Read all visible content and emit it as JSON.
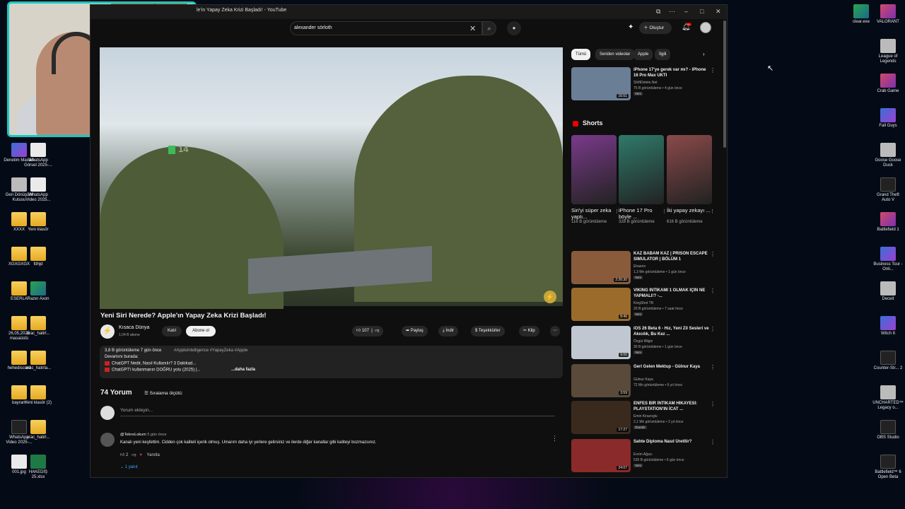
{
  "browser": {
    "tab_title": "le'in Yapay Zeka Krizi Başladı! - YouTube",
    "search_value": "alexander sörloth",
    "create_label": "Oluştur",
    "notif_count": "9+"
  },
  "video": {
    "badge": "14",
    "title": "Yeni Siri Nerede? Apple'ın Yapay Zeka Krizi Başladı!",
    "channel": "Kısaca Dünya",
    "subs": "1,04 B abone",
    "join": "Katıl",
    "subscribe": "Abone ol",
    "likes": "107",
    "share": "Paylaş",
    "download": "İndir",
    "thanks": "Teşekkürler",
    "clip": "Klip"
  },
  "description": {
    "stats": "3,8 B görüntüleme  7 gün önce",
    "tags": "#AppleIntelligence #YapayZeka #Apple",
    "line1": "Devamını burada:",
    "line2": "ChatGPT Nedir, Nasıl Kullanılır? 3 Dakikad...",
    "line3": "ChatGPT'i kullanmanın DOĞRU yolu (2025) |...",
    "more": "...daha fazla"
  },
  "comments": {
    "count": "74 Yorum",
    "sort": "Sıralama ölçütü:",
    "add_placeholder": "Yorum ekleyin...",
    "user": "@TeknoLokum",
    "time": "5 gün önce",
    "text": "Kanalı yeni keşfettim. Cidden çok kaliteli içerik olmuş. Umarım daha iyi yerlere gelirsiniz ve ilerde diğer kanallar gibi kaliteyi bozmazsınız.",
    "likes": "2",
    "reply": "Yanıtla",
    "replies": "1 yanıt"
  },
  "chips": [
    "Tümü",
    "Seriden videolar",
    "Apple",
    "İlgili"
  ],
  "recs": [
    {
      "title": "iPhone 17'ye gerek var mı? - iPhone 16 Pro Max UKTI",
      "channel": "ShiftDelete.Net",
      "views": "75 B görüntüleme • 4 gün önce",
      "badge": "Yeni",
      "dur": "16:51",
      "thumb": "#6a7f96"
    },
    {
      "title": "KAZ BABAM KAZ | PRISON ESCAPE SIMULATOR | BÖLÜM 1",
      "channel": "Elraenn",
      "views": "1,3 Mn görüntüleme • 1 gün önce",
      "badge": "Yeni",
      "dur": "2:26:30",
      "thumb": "#8a5b3a"
    },
    {
      "title": "VİKİNG İNTİKAMI 1 OLMAK İÇİN NE YAPMALI!? -...",
      "channel": "KingShot TR",
      "views": "20 B görüntüleme • 7 saat önce",
      "badge": "Yeni",
      "dur": "8:46",
      "thumb": "#9a6b2a"
    },
    {
      "title": "iOS 26 Beta 6 - Hız, Yeni Zil Sesleri ve Akıcılık, Bu Kez ...",
      "channel": "Özgür Bilgin",
      "views": "30 B görüntüleme • 1 gün önce",
      "badge": "Yeni",
      "dur": "9:00",
      "thumb": "#c0c7d0"
    },
    {
      "title": "Geri Gelen Mektup - Gülnur Kaya",
      "channel": "Gülnur Kaya",
      "views": "72 Mn görüntüleme • 6 yıl önce",
      "badge": "",
      "dur": "3:59",
      "thumb": "#5a4a3a"
    },
    {
      "title": "ENFES BİR İNTİKAM HİKAYESİ: PLAYSTATION'IN İCAT ...",
      "channel": "Emin Kirazoglu",
      "views": "2,1 Mn görüntüleme • 2 yıl önce",
      "badge": "Önerilir",
      "dur": "17:27",
      "thumb": "#3a2a1e"
    },
    {
      "title": "Sahte Diploma Nasıl Üretilir?",
      "channel": "Evrim Ağacı",
      "views": "535 B görüntüleme • 6 gün önce",
      "badge": "Yeni",
      "dur": "24:07",
      "thumb": "#8a2a2a"
    }
  ],
  "shorts": {
    "label": "Shorts",
    "items": [
      {
        "title": "Siri'yi süper zeka yaptı...",
        "views": "116 B görüntüleme",
        "color": "#7a3a8a"
      },
      {
        "title": "iPhone 17 Pro böyle ...",
        "views": "328 B görüntüleme",
        "color": "#2f7a6a"
      },
      {
        "title": "İki yapay zekayı ...",
        "views": "616 B görüntüleme",
        "color": "#8a4a4a"
      }
    ]
  },
  "desktop_left": [
    {
      "label": "Denetim Masası",
      "cls": "app"
    },
    {
      "label": "WhatsApp Görsel 2025-...",
      "cls": "doc"
    },
    {
      "label": "Geri Dönüşüm Kutusu",
      "cls": "app4"
    },
    {
      "label": "WhatsApp Video 2025...",
      "cls": "doc"
    },
    {
      "label": "XXXX",
      "cls": "folder"
    },
    {
      "label": "Yeni klasör",
      "cls": "folder"
    },
    {
      "label": "XGXGXGX",
      "cls": "folder"
    },
    {
      "label": "fdhjd",
      "cls": "folder"
    },
    {
      "label": "ESERLA",
      "cls": "folder"
    },
    {
      "label": "Razer Axon",
      "cls": "app3"
    },
    {
      "label": "26,05,2025 masaüstü",
      "cls": "folder"
    },
    {
      "label": "arac_hatirl...",
      "cls": "folder"
    },
    {
      "label": "hehediscord",
      "cls": "folder"
    },
    {
      "label": "arac_hatirla...",
      "cls": "folder"
    },
    {
      "label": "bayram",
      "cls": "folder"
    },
    {
      "label": "Yeni klasör (2)",
      "cls": "folder"
    },
    {
      "label": "WhatsApp Video 2025-...",
      "cls": "app5"
    },
    {
      "label": "arac_hatirl...",
      "cls": "folder"
    },
    {
      "label": "001.jpg",
      "cls": "doc"
    },
    {
      "label": "HAKEDİŞ 25.xlsx",
      "cls": "xls"
    }
  ],
  "desktop_right": [
    {
      "label": "clear.exe",
      "cls": "app3"
    },
    {
      "label": "VALORANT",
      "cls": "app2"
    },
    {
      "label": "League of Legends",
      "cls": "app4"
    },
    {
      "label": "Crab Game",
      "cls": "app2"
    },
    {
      "label": "Fall Guys",
      "cls": "app"
    },
    {
      "label": "Goose Goose Duck",
      "cls": "app4"
    },
    {
      "label": "Grand Theft Auto V",
      "cls": "app5"
    },
    {
      "label": "Battlefield 1",
      "cls": "app2"
    },
    {
      "label": "Business Tour - Onli...",
      "cls": "app"
    },
    {
      "label": "Deceit",
      "cls": "app4"
    },
    {
      "label": "Witch It",
      "cls": "app"
    },
    {
      "label": "Counter-Str... 2",
      "cls": "app5"
    },
    {
      "label": "UNCHARTED™ Legacy o...",
      "cls": "app4"
    },
    {
      "label": "OBS Studio",
      "cls": "app5"
    },
    {
      "label": "Battlefield™ 6 Open Beta",
      "cls": "app5"
    }
  ]
}
